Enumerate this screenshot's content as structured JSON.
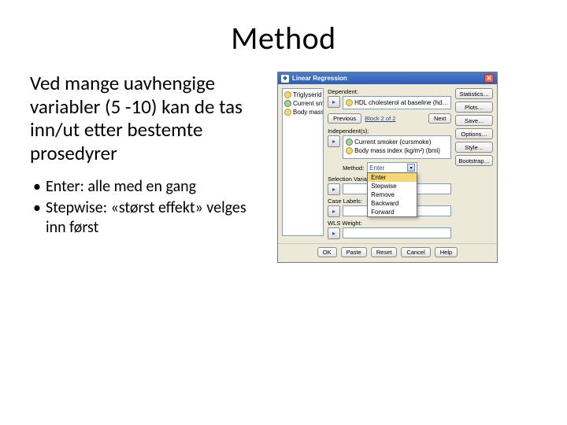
{
  "title": "Method",
  "intro": "Ved mange uavhengige variabler (5 -10) kan de tas inn/ut etter bestemte prosedyrer",
  "bullets": [
    "Enter: alle med en gang",
    "Stepwise: «størst effekt» velges inn først"
  ],
  "spss": {
    "window_title": "Linear Regression",
    "close_glyph": "✕",
    "var_list": [
      {
        "label": "Triglyserid (tric)",
        "icon": "scale"
      },
      {
        "label": "Current smoker (curs…",
        "icon": "nom"
      },
      {
        "label": "Body mass index (kg…",
        "icon": "scale"
      }
    ],
    "labels": {
      "dependent": "Dependent:",
      "block": "Block 2 of 2",
      "previous": "Previous",
      "next": "Next",
      "independent": "Independent(s):",
      "method": "Method:",
      "selection": "Selection Variable:",
      "case": "Case Labels:",
      "wls": "WLS Weight:"
    },
    "dependent_value": "HDL cholesterol at baseline (hd…",
    "independents": [
      {
        "label": "Current smoker (cursmoke)",
        "icon": "nom"
      },
      {
        "label": "Body mass index (kg/m²) (bmi)",
        "icon": "scale"
      }
    ],
    "method_value": "Enter",
    "method_options": [
      "Enter",
      "Stepwise",
      "Remove",
      "Backward",
      "Forward"
    ],
    "right_buttons": [
      "Statistics…",
      "Plots…",
      "Save…",
      "Options…",
      "Style…",
      "Bootstrap…"
    ],
    "footer_buttons": [
      "OK",
      "Paste",
      "Reset",
      "Cancel",
      "Help"
    ]
  }
}
